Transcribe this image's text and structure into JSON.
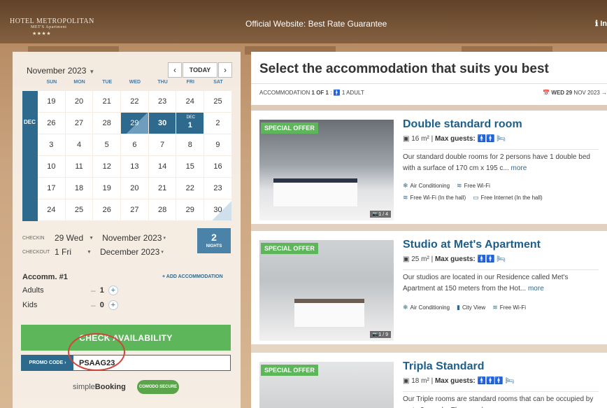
{
  "header": {
    "logo_line1": "HOTEL METROPOLITAN",
    "logo_line2": "MET'S Apartment",
    "logo_stars": "★★★★",
    "message": "Official Website: Best Rate Guarantee",
    "info": "ℹ In"
  },
  "calendar": {
    "month_label": "November 2023",
    "today_label": "TODAY",
    "prev_icon": "‹",
    "next_icon": "›",
    "weekdays": [
      "SUN",
      "MON",
      "TUE",
      "WED",
      "THU",
      "FRI",
      "SAT"
    ],
    "month_marker": "DEC",
    "rows": [
      [
        "19",
        "20",
        "21",
        "22",
        "23",
        "24",
        "25"
      ],
      [
        "26",
        "27",
        "28",
        "29",
        "30",
        "1",
        "2"
      ],
      [
        "3",
        "4",
        "5",
        "6",
        "7",
        "8",
        "9"
      ],
      [
        "10",
        "11",
        "12",
        "13",
        "14",
        "15",
        "16"
      ],
      [
        "17",
        "18",
        "19",
        "20",
        "21",
        "22",
        "23"
      ],
      [
        "24",
        "25",
        "26",
        "27",
        "28",
        "29",
        "30"
      ]
    ],
    "dec_mini": "DEC"
  },
  "dates": {
    "checkin_label": "CHECKIN",
    "checkin_day": "29 Wed",
    "checkin_month": "November 2023",
    "checkout_label": "CHECKOUT",
    "checkout_day": "1 Fri",
    "checkout_month": "December 2023",
    "nights_value": "2",
    "nights_label": "NIGHTS"
  },
  "guests": {
    "accomm_label": "Accomm. #1",
    "add_accomm": "+ ADD ACCOMMODATION",
    "adults_label": "Adults",
    "adults_value": "1",
    "kids_label": "Kids",
    "kids_value": "0",
    "minus": "–",
    "plus": "+"
  },
  "check_button": "CHECK AVAILABILITY",
  "promo": {
    "label": "PROMO CODE ›",
    "value": "PSAAG23"
  },
  "footer": {
    "brand_prefix": "simple",
    "brand_bold": "Booking",
    "badge": "COMODO SECURE"
  },
  "results": {
    "title": "Select the accommodation that suits you best",
    "sub_prefix": "ACCOMMODATION",
    "sub_count": "1 OF 1",
    "sub_guests": ": 🚹 1 ADULT",
    "date_prefix": "📅",
    "date_value": "WED 29",
    "date_suffix": "NOV 2023 →",
    "rooms": [
      {
        "offer": "SPECIAL OFFER",
        "photo_count": "📷1 / 4",
        "title": "Double standard room",
        "size": "16 m²",
        "max_label": "Max guests:",
        "people": "🚹🚹 🛏",
        "desc": "Our standard double rooms for 2 persons have 1 double bed with a surface of 170 cm x 195 c...",
        "more": "more",
        "amenities1": [
          "Air Conditioning",
          "Free Wi-Fi"
        ],
        "amenities2": [
          "Free Wi-Fi (In the hall)",
          "Free Internet (In the hall)"
        ]
      },
      {
        "offer": "SPECIAL OFFER",
        "photo_count": "📷1 / 9",
        "title": "Studio at Met's Apartment",
        "size": "25 m²",
        "max_label": "Max guests:",
        "people": "🚹🚹 🛏",
        "desc": "Our studios are located in our Residence called Met's Apartment at 150 meters from the Hot...",
        "more": "more",
        "amenities1": [
          "Air Conditioning",
          "City View",
          "Free Wi-Fi"
        ]
      },
      {
        "offer": "SPECIAL OFFER",
        "title": "Tripla Standard",
        "size": "18 m²",
        "max_label": "Max guests:",
        "people": "🚹🚹🚹 🛏",
        "desc": "Our Triple rooms are standard rooms that can be occupied by up to 3 people. They can be co...",
        "more": "more"
      }
    ]
  },
  "colors": {
    "accent": "#2e6a8e",
    "green": "#5db65a",
    "title_blue": "#1d5f8a"
  }
}
